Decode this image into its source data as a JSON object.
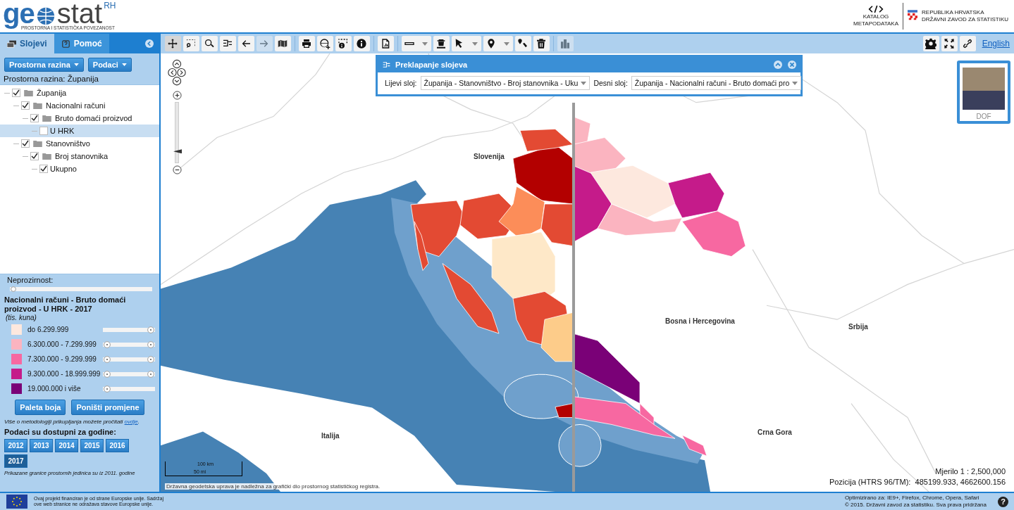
{
  "header": {
    "logo_left": "ge",
    "logo_right": "stat",
    "logo_sup": "RH",
    "tagline": "PROSTORNA I STATISTIČKA POVEZANOST",
    "catalog": "KATALOG METAPODATAKA",
    "institution": [
      "REPUBLIKA HRVATSKA",
      "DRŽAVNI ZAVOD ZA STATISTIKU"
    ]
  },
  "sidebar": {
    "tabs": [
      {
        "label": "Slojevi",
        "kind": "layers",
        "selected": true
      },
      {
        "label": "Pomoć",
        "kind": "help",
        "selected": false
      }
    ],
    "menus": [
      "Prostorna razina",
      "Podaci"
    ],
    "level_text": "Prostorna razina: Županija",
    "tree": [
      {
        "label": "Županija",
        "checked": true,
        "selected": false,
        "children": [
          {
            "label": "Nacionalni računi",
            "checked": true,
            "selected": false,
            "children": [
              {
                "label": "Bruto domaći proizvod",
                "checked": true,
                "selected": false,
                "children": [
                  {
                    "label": "U HRK",
                    "checked": false,
                    "selected": true
                  }
                ]
              }
            ]
          },
          {
            "label": "Stanovništvo",
            "checked": true,
            "selected": false,
            "children": [
              {
                "label": "Broj stanovnika",
                "checked": true,
                "selected": false,
                "children": [
                  {
                    "label": "Ukupno",
                    "checked": true,
                    "selected": false
                  }
                ]
              }
            ]
          }
        ]
      }
    ],
    "opacity": {
      "label": "Neprozirnost:",
      "level": 0
    },
    "legend": {
      "title": "Nacionalni računi - Bruto domaći proizvod - U HRK - 2017",
      "unit": "(tis. kuna)",
      "classes": [
        {
          "label": "do 6.299.999",
          "color": "#fde8de",
          "thumbs": [
            {
              "level": 1
            }
          ]
        },
        {
          "label": "6.300.000 - 7.299.999",
          "color": "#fbb4c0",
          "thumbs": [
            {
              "level": 0
            },
            {
              "level": 1
            }
          ]
        },
        {
          "label": "7.300.000 - 9.299.999",
          "color": "#f768a1",
          "thumbs": [
            {
              "level": 0
            },
            {
              "level": 1
            }
          ]
        },
        {
          "label": "9.300.000 - 18.999.999",
          "color": "#c51b8a",
          "thumbs": [
            {
              "level": 0
            },
            {
              "level": 1
            }
          ]
        },
        {
          "label": "19.000.000 i više",
          "color": "#7a0177",
          "thumbs": [
            {
              "level": 0
            }
          ]
        }
      ]
    },
    "legend_buttons": [
      "Paleta boja",
      "Poništi promjene"
    ],
    "method_note": "Više o metodologiji prikupljanja možete pročitati",
    "method_link": "ovdje",
    "method_end": ".",
    "years_title": "Podaci su dostupni za godine:",
    "years": [
      {
        "label": "2012",
        "selected": false
      },
      {
        "label": "2013",
        "selected": false
      },
      {
        "label": "2014",
        "selected": false
      },
      {
        "label": "2015",
        "selected": false
      },
      {
        "label": "2016",
        "selected": false
      },
      {
        "label": "2017",
        "selected": true
      }
    ],
    "boundary_note": "Prikazane granice prostornih jedinica su iz 2011. godine"
  },
  "toolbar": {
    "tools": [
      {
        "kind": "pan",
        "disabled": false,
        "selected": true,
        "dropdown": false
      },
      {
        "kind": "zoom-box",
        "disabled": false,
        "selected": false,
        "dropdown": false
      },
      {
        "kind": "search",
        "disabled": false,
        "selected": false,
        "dropdown": false
      },
      {
        "kind": "compare",
        "disabled": false,
        "selected": false,
        "dropdown": false
      },
      {
        "kind": "back",
        "disabled": false,
        "selected": false,
        "dropdown": false
      },
      {
        "kind": "forward",
        "disabled": true,
        "selected": false,
        "dropdown": false
      },
      {
        "kind": "map",
        "disabled": false,
        "selected": false,
        "dropdown": false
      },
      {
        "kind": "print",
        "disabled": false,
        "selected": false,
        "dropdown": false
      },
      {
        "kind": "globe",
        "disabled": false,
        "selected": false,
        "dropdown": false
      },
      {
        "kind": "info-box",
        "disabled": false,
        "selected": false,
        "dropdown": false
      },
      {
        "kind": "info",
        "disabled": false,
        "selected": false,
        "dropdown": false
      },
      {
        "kind": "report",
        "disabled": false,
        "selected": false,
        "dropdown": false
      },
      {
        "kind": "ruler",
        "disabled": false,
        "selected": false,
        "dropdown": true
      },
      {
        "kind": "clear-ruler",
        "disabled": false,
        "selected": false,
        "dropdown": false
      },
      {
        "kind": "pointer",
        "disabled": false,
        "selected": false,
        "dropdown": true
      },
      {
        "kind": "pin",
        "disabled": false,
        "selected": false,
        "dropdown": true
      },
      {
        "kind": "pin-edit",
        "disabled": false,
        "selected": false,
        "dropdown": false
      },
      {
        "kind": "trash",
        "disabled": false,
        "selected": false,
        "dropdown": false
      },
      {
        "kind": "buildings",
        "disabled": true,
        "selected": false,
        "dropdown": false
      }
    ],
    "right_tools": [
      {
        "kind": "settings"
      },
      {
        "kind": "fullscreen"
      },
      {
        "kind": "link"
      }
    ],
    "language": "English"
  },
  "compare_panel": {
    "title": "Preklapanje slojeva",
    "left_label": "Lijevi sloj:",
    "left_value": "Županija - Stanovništvo - Broj stanovnika - Uku",
    "right_label": "Desni sloj:",
    "right_value": "Županija - Nacionalni računi - Bruto domaći pro"
  },
  "map": {
    "labels": [
      {
        "text": "Slovenija",
        "kind": "country"
      },
      {
        "text": "Bosna i Hercegovina",
        "kind": "country"
      },
      {
        "text": "Srbija",
        "kind": "country"
      },
      {
        "text": "Italija",
        "kind": "country"
      },
      {
        "text": "Crna Gora",
        "kind": "country"
      }
    ],
    "basemap": "DOF",
    "scale_km": "100 km",
    "scale_mi": "50 mi",
    "attribution": "Državna geodetska uprava je nadležna za grafički dio prostornog statističkog registra.",
    "scale_text": "Mjerilo 1 : 2,500,000",
    "position_label": "Pozicija (HTRS 96/TM):",
    "position_value": "485199.933, 4662600.156",
    "zoom": {
      "level": 0.15
    }
  },
  "footer": {
    "eu_text": "Ovaj projekt financiran je od strane Europske unije. Sadržaj ove web stranice ne odražava stavove Europske unije.",
    "browsers": "Optimizirano za: IE9+, Firefox, Chrome, Opera, Safari",
    "copyright": "© 2015. Državni zavod za statistiku. Sva prava pridržana",
    "help": "?"
  }
}
